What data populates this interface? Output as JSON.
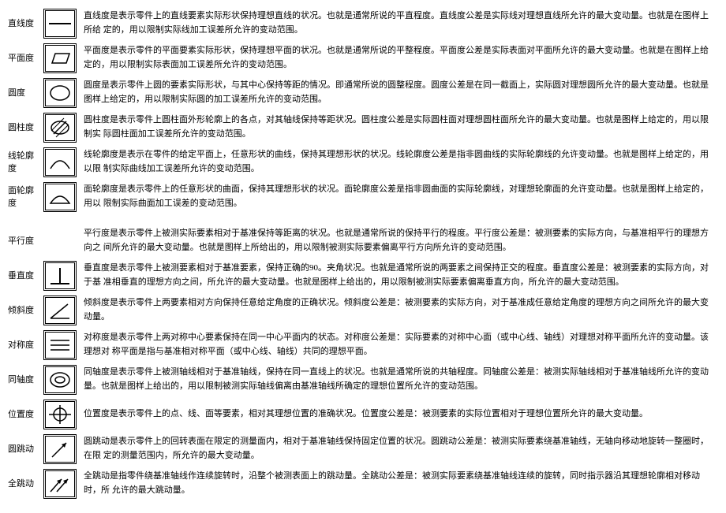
{
  "rows": [
    {
      "label": "直线度",
      "icon": "straightness",
      "desc": "直线度是表示零件上的直线要素实际形状保持理想直线的状况。也就是通常所说的平直程度。直线度公差是实际线对理想直线所允许的最大变动量。也就是在图样上所给 定的，用以限制实际线加工误差所允许的变动范围。"
    },
    {
      "label": "平面度",
      "icon": "flatness",
      "desc": "平面度是表示零件的平面要素实际形状，保持理想平面的状况。也就是通常所说的平整程度。平面度公差是实际表面对平面所允许的最大变动量。也就是在图样上给定的，用以限制实际表面加工误差所允许的变动范围。"
    },
    {
      "label": "圆度",
      "icon": "roundness",
      "desc": "圆度是表示零件上圆的要素实际形状，与其中心保持等距的情况。即通常所说的圆整程度。圆度公差是在同一截面上，实际圆对理想圆所允许的最大变动量。也就是图样上给定的，用以限制实际圆的加工误差所允许的变动范围。"
    },
    {
      "label": "圆柱度",
      "icon": "cylindricity",
      "desc": "圆柱度是表示零件上圆柱面外形轮廓上的各点，对其轴线保持等距状况。圆柱度公差是实际圆柱面对理想圆柱面所允许的最大变动量。也就是图样上给定的，用以限制实 际圆柱面加工误差所允许的变动范围。"
    },
    {
      "label": "线轮廓度",
      "icon": "line-profile",
      "desc": "线轮廓度是表示在零件的给定平面上，任意形状的曲线，保持其理想形状的状况。线轮廓度公差是指非圆曲线的实际轮廓线的允许变动量。也就是图样上给定的，用以限 制实际曲线加工误差所允许的变动范围。"
    },
    {
      "label": "面轮廓度",
      "icon": "surface-profile",
      "desc": "面轮廓度是表示零件上的任意形状的曲面，保持其理想形状的状况。面轮廓度公差是指非圆曲面的实际轮廓线，对理想轮廓面的允许变动量。也就是图样上给定的，用以 限制实际曲面加工误差的变动范围。"
    },
    {
      "spacer": true
    },
    {
      "label": "平行度",
      "icon": "none",
      "desc": "平行度是表示零件上被测实际要素相对于基准保持等距离的状况。也就是通常所说的保持平行的程度。平行度公差是：被测要素的实际方向，与基准相平行的理想方向之 间所允许的最大变动量。也就是图样上所给出的，用以限制被测实际要素偏离平行方向所允许的变动范围。"
    },
    {
      "label": "垂直度",
      "icon": "perpendicularity",
      "desc": "垂直度是表示零件上被测要素相对于基准要素，保持正确的90。夹角状况。也就是通常所说的两要素之间保持正交的程度。垂直度公差是：被测要素的实际方向，对于基 准相垂直的理想方向之间，所允许的最大变动量。也就是图样上给出的，用以限制被测实际要素偏离垂直方向，所允许的最大变动范围。"
    },
    {
      "label": "倾斜度",
      "icon": "angularity",
      "desc": "倾斜度是表示零件上两要素相对方向保持任意给定角度的正确状况。倾斜度公差是：被测要素的实际方向，对于基准成任意给定角度的理想方向之间所允许的最大变动量。"
    },
    {
      "label": "对称度",
      "icon": "symmetry",
      "desc": "对称度是表示零件上两对称中心要素保持在同一中心平面内的状态。对称度公差是：实际要素的对称中心面（或中心线、轴线）对理想对称平面所允许的变动量。该理想对 称平面是指与基准相对称平面（或中心线、轴线）共同的理想平面。"
    },
    {
      "label": "同轴度",
      "icon": "concentricity",
      "desc": "同轴度是表示零件上被测轴线相对于基准轴线，保持在同一直线上的状况。也就是通常所说的共轴程度。同轴度公差是：被测实际轴线相对于基准轴线所允许的变动量。也就是图样上给出的，用以限制被测实际轴线偏离由基准轴线所确定的理想位置所允许的变动范围。"
    },
    {
      "label": "位置度",
      "icon": "position",
      "desc": "位置度是表示零件上的点、线、面等要素，相对其理想位置的准确状况。位置度公差是：被测要素的实际位置相对于理想位置所允许的最大变动量。"
    },
    {
      "label": "圆跳动",
      "icon": "circular-runout",
      "desc": "圆跳动是表示零件上的回转表面在限定的测量面内，相对于基准轴线保持固定位置的状况。圆跳动公差是：被测实际要素绕基准轴线，无轴向移动地旋转一整圈时，在限 定的测量范围内，所允许的最大变动量。"
    },
    {
      "label": "全跳动",
      "icon": "total-runout",
      "desc": "全跳动是指零件绕基准轴线作连续旋转时，沿整个被测表面上的跳动量。全跳动公差是：被测实际要素绕基准轴线连续的旋转，同时指示器沿其理想轮廓相对移动时，所 允许的最大跳动量。"
    }
  ]
}
